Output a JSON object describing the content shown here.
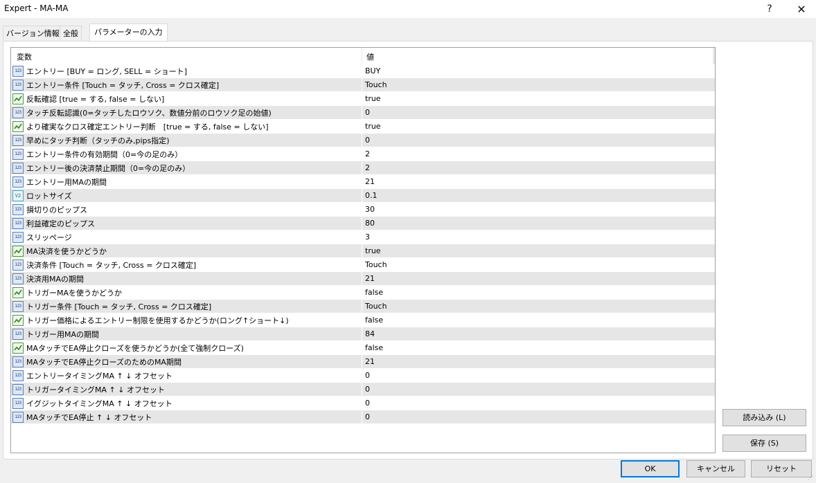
{
  "window": {
    "title": "Expert - MA-MA",
    "help_label": "?",
    "close_label": "✕"
  },
  "tabs": [
    {
      "label": "バージョン情報",
      "active": false
    },
    {
      "label": "全般",
      "active": false
    },
    {
      "label": "パラメーターの入力",
      "active": true
    }
  ],
  "grid": {
    "headers": {
      "name": "変数",
      "value": "値"
    },
    "rows": [
      {
        "type": "int",
        "name": "エントリー [BUY = ロング, SELL = ショート]",
        "value": "BUY"
      },
      {
        "type": "int",
        "name": "エントリー条件 [Touch = タッチ, Cross = クロス確定]",
        "value": "Touch"
      },
      {
        "type": "bool",
        "name": "反転確認 [true = する, false = しない]",
        "value": "true"
      },
      {
        "type": "int",
        "name": "タッチ反転認識(0=タッチしたロウソク、数値分前のロウソク足の始値)",
        "value": "0"
      },
      {
        "type": "bool",
        "name": "より確実なクロス確定エントリー判断　[true = する, false = しない]",
        "value": "true"
      },
      {
        "type": "int",
        "name": "早めにタッチ判断（タッチのみ,pips指定)",
        "value": "0"
      },
      {
        "type": "int",
        "name": "エントリー条件の有効期間（0=今の足のみ）",
        "value": "2"
      },
      {
        "type": "int",
        "name": "エントリー後の決済禁止期間（0=今の足のみ）",
        "value": "2"
      },
      {
        "type": "int",
        "name": "エントリー用MAの期間",
        "value": "21"
      },
      {
        "type": "double",
        "name": "ロットサイズ",
        "value": "0.1"
      },
      {
        "type": "int",
        "name": "損切りのピップス",
        "value": "30"
      },
      {
        "type": "int",
        "name": "利益確定のピップス",
        "value": "80"
      },
      {
        "type": "int",
        "name": "スリッページ",
        "value": "3"
      },
      {
        "type": "bool",
        "name": "MA決済を使うかどうか",
        "value": "true"
      },
      {
        "type": "int",
        "name": "決済条件 [Touch = タッチ, Cross = クロス確定]",
        "value": "Touch"
      },
      {
        "type": "int",
        "name": "決済用MAの期間",
        "value": "21"
      },
      {
        "type": "bool",
        "name": "トリガーMAを使うかどうか",
        "value": "false"
      },
      {
        "type": "int",
        "name": "トリガー条件 [Touch = タッチ, Cross = クロス確定]",
        "value": "Touch"
      },
      {
        "type": "bool",
        "name": "トリガー価格によるエントリー制限を使用するかどうか(ロング↑ショート↓)",
        "value": "false"
      },
      {
        "type": "int",
        "name": "トリガー用MAの期間",
        "value": "84"
      },
      {
        "type": "bool",
        "name": "MAタッチでEA停止クローズを使うかどうか(全て強制クローズ)",
        "value": "false"
      },
      {
        "type": "int",
        "name": "MAタッチでEA停止クローズのためのMA期間",
        "value": "21"
      },
      {
        "type": "int",
        "name": "エントリータイミングMA ↑ ↓ オフセット",
        "value": "0"
      },
      {
        "type": "int",
        "name": "トリガータイミングMA ↑ ↓ オフセット",
        "value": "0"
      },
      {
        "type": "int",
        "name": "イグジットタイミングMA ↑ ↓ オフセット",
        "value": "0"
      },
      {
        "type": "int",
        "name": "MAタッチでEA停止 ↑ ↓ オフセット",
        "value": "0"
      }
    ]
  },
  "icons": {
    "int": {
      "name": "integer-type-icon",
      "glyph": "123"
    },
    "bool": {
      "name": "boolean-type-icon",
      "glyph": ""
    },
    "double": {
      "name": "double-type-icon",
      "glyph": "V2"
    }
  },
  "buttons": {
    "load": "読み込み (L)",
    "save": "保存 (S)",
    "ok": "OK",
    "cancel": "キャンセル",
    "reset": "リセット"
  },
  "colors": {
    "accent": "#0078d7",
    "row_alt": "#e6e6e6"
  }
}
